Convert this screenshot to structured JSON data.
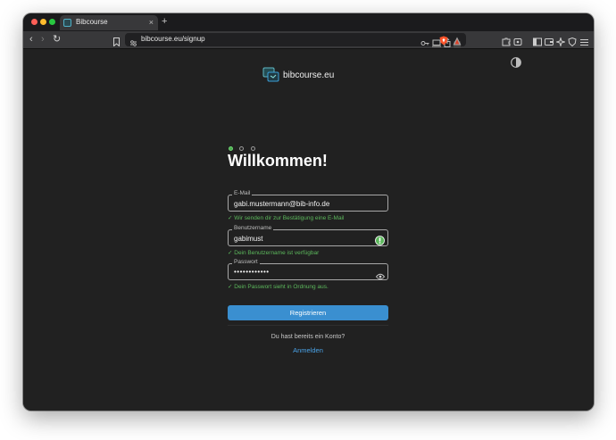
{
  "browser": {
    "tab_title": "Bibcourse",
    "tab_close": "×",
    "new_tab": "+",
    "url": "bibcourse.eu/signup",
    "nav_back": "‹",
    "nav_forward": "›",
    "nav_reload": "↻"
  },
  "header": {
    "brand": "bibcourse.eu",
    "logo_icon": "bibcourse-logo",
    "theme_icon": "contrast-toggle-icon"
  },
  "signup": {
    "step_count": 3,
    "current_step": 1,
    "heading": "Willkommen!",
    "email": {
      "label": "E-Mail",
      "value": "gabi.mustermann@bib-info.de",
      "hint": "✓ Wir senden dir zur Bestätigung eine E-Mail"
    },
    "username": {
      "label": "Benutzername",
      "value": "gabimust",
      "hint": "✓ Dein Benutzername ist verfügbar"
    },
    "password": {
      "label": "Passwort",
      "value": "••••••••••••",
      "hint": "✓ Dein Passwort sieht in Ordnung aus."
    },
    "submit_label": "Registrieren",
    "login_question": "Du hast bereits ein Konto?",
    "login_link": "Anmelden"
  },
  "colors": {
    "accent": "#3a8fd0",
    "success": "#5cb85c",
    "link": "#4aa3e8",
    "background": "#212121"
  }
}
